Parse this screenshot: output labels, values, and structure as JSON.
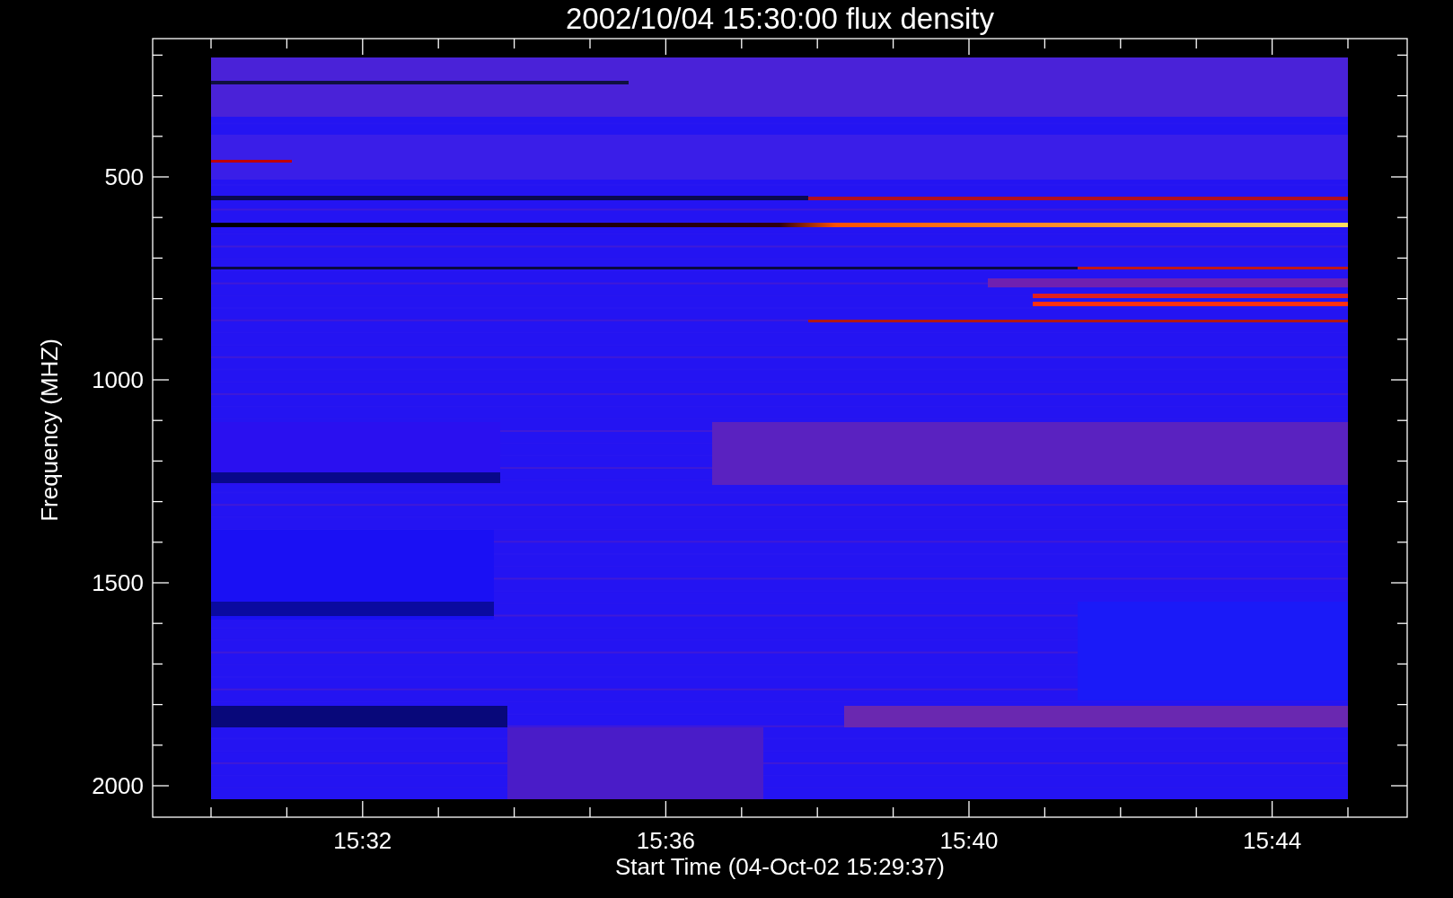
{
  "plot": {
    "title": "2002/10/04 15:30:00 flux density",
    "xlabel": "Start Time (04-Oct-02 15:29:37)",
    "ylabel": "Frequency (MHZ)",
    "xtick_labels": [
      "15:32",
      "15:36",
      "15:40",
      "15:44"
    ],
    "ytick_labels": [
      "500",
      "1000",
      "1500",
      "2000"
    ]
  }
}
